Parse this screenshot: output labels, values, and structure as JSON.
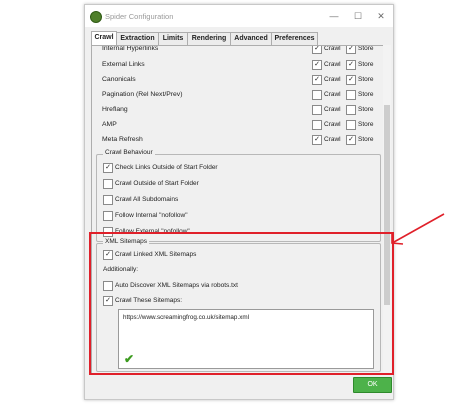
{
  "window": {
    "title": "Spider Configuration",
    "minimize": "—",
    "maximize": "☐",
    "close": "✕"
  },
  "tabs": [
    {
      "label": "Crawl",
      "active": true
    },
    {
      "label": "Extraction"
    },
    {
      "label": "Limits"
    },
    {
      "label": "Rendering"
    },
    {
      "label": "Advanced"
    },
    {
      "label": "Preferences"
    }
  ],
  "resources": [
    {
      "name": "Internal Hyperlinks",
      "crawl": true,
      "store": true
    },
    {
      "name": "External Links",
      "crawl": true,
      "store": true
    },
    {
      "name": "Canonicals",
      "crawl": true,
      "store": true
    },
    {
      "name": "Pagination (Rel Next/Prev)",
      "crawl": false,
      "store": false
    },
    {
      "name": "Hreflang",
      "crawl": false,
      "store": false
    },
    {
      "name": "AMP",
      "crawl": false,
      "store": false
    },
    {
      "name": "Meta Refresh",
      "crawl": true,
      "store": true
    }
  ],
  "col_labels": {
    "crawl": "Crawl",
    "store": "Store"
  },
  "crawl_behaviour": {
    "title": "Crawl Behaviour",
    "items": [
      {
        "label": "Check Links Outside of Start Folder",
        "checked": true
      },
      {
        "label": "Crawl Outside of Start Folder",
        "checked": false
      },
      {
        "label": "Crawl All Subdomains",
        "checked": false
      },
      {
        "label": "Follow Internal \"nofollow\"",
        "checked": false
      },
      {
        "label": "Follow External \"nofollow\"",
        "checked": false
      }
    ]
  },
  "xml_sitemaps": {
    "title": "XML Sitemaps",
    "crawl_linked": {
      "label": "Crawl Linked XML Sitemaps",
      "checked": true
    },
    "additionally": "Additionally:",
    "auto_discover": {
      "label": "Auto Discover XML Sitemaps via robots.txt",
      "checked": false
    },
    "crawl_these": {
      "label": "Crawl These Sitemaps:",
      "checked": true
    },
    "sitemap_url": "https://www.screamingfrog.co.uk/sitemap.xml",
    "valid_mark": "✔"
  },
  "ok_label": "OK",
  "check_mark": "✓",
  "colors": {
    "ok": "#4db24a",
    "highlight": "#e0202a",
    "valid": "#3c9b1f"
  }
}
